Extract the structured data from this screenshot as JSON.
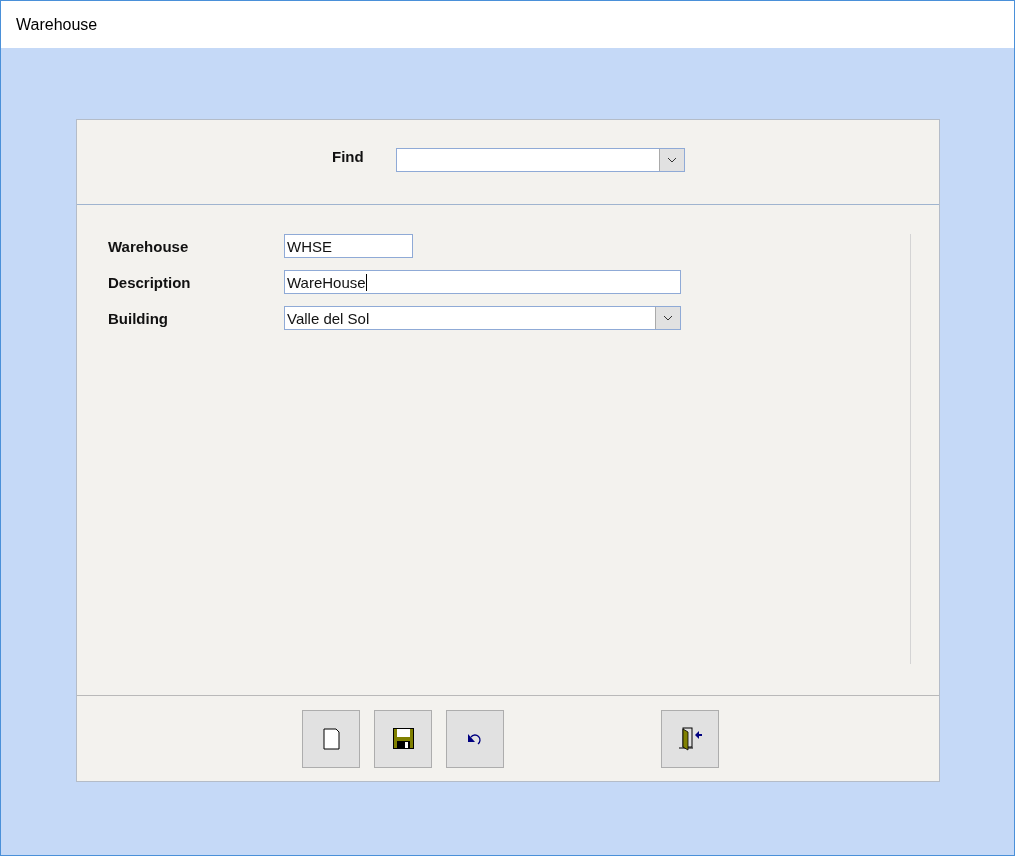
{
  "window": {
    "title": "Warehouse"
  },
  "find": {
    "label": "Find"
  },
  "fields": [
    {
      "label": "Warehouse",
      "kind": "text",
      "value": "WHSE",
      "focused": false
    },
    {
      "label": "Description",
      "kind": "text",
      "value": "WareHouse",
      "focused": true
    },
    {
      "label": "Building",
      "kind": "combo",
      "value": "Valle del Sol",
      "focused": false
    }
  ],
  "buttons": [
    {
      "kind": "new"
    },
    {
      "kind": "save"
    },
    {
      "kind": "undo"
    },
    {
      "kind": "exit"
    }
  ]
}
